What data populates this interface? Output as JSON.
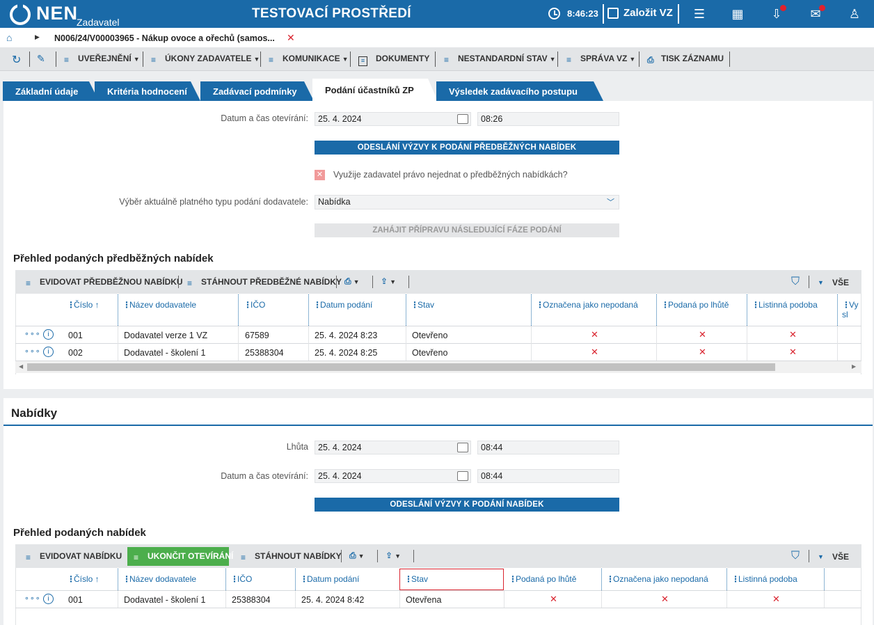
{
  "topbar": {
    "logo": "NEN",
    "logo_sub": "Zadavatel",
    "env_title": "TESTOVACÍ PROSTŘEDÍ",
    "time": "8:46:23",
    "create_label": "Založit VZ",
    "accent": "#1a6aa8"
  },
  "breadcrumb": {
    "text": "N006/24/V00003965 - Nákup ovoce a ořechů (samos..."
  },
  "toolbar": {
    "items": [
      "UVEŘEJNĚNÍ",
      "ÚKONY ZADAVATELE",
      "KOMUNIKACE",
      "DOKUMENTY",
      "NESTANDARDNÍ STAV",
      "SPRÁVA VZ",
      "TISK ZÁZNAMU"
    ]
  },
  "tabs": [
    "Základní údaje",
    "Kritéria hodnocení",
    "Zadávací podmínky",
    "Podání účastníků ZP",
    "Výsledek zadávacího postupu"
  ],
  "prelim": {
    "open_label": "Datum a čas otevírání:",
    "open_date": "25. 4. 2024",
    "open_time": "08:26",
    "send_btn": "ODESLÁNÍ VÝZVY K PODÁNÍ PŘEDBĚŽNÝCH NABÍDEK",
    "checkbox_label": "Využije zadavatel právo nejednat o předběžných nabídkách?",
    "type_label": "Výběr aktuálně platného typu podání dodavatele:",
    "type_value": "Nabídka",
    "next_btn": "ZAHÁJIT PŘÍPRAVU NÁSLEDUJÍCÍ FÁZE PODÁNÍ",
    "section_title": "Přehled podaných předběžných nabídek",
    "grid_actions": [
      "EVIDOVAT PŘEDBĚŽNOU NABÍDKU",
      "STÁHNOUT PŘEDBĚŽNÉ NABÍDKY"
    ],
    "filter_all": "VŠE",
    "columns": [
      "Číslo",
      "Název dodavatele",
      "IČO",
      "Datum podání",
      "Stav",
      "Označena jako nepodaná",
      "Podaná po lhůtě",
      "Listinná podoba",
      "Vy sl"
    ],
    "rows": [
      {
        "cislo": "001",
        "nazev": "Dodavatel verze 1 VZ",
        "ico": "67589",
        "datum": "25. 4. 2024 8:23",
        "stav": "Otevřeno"
      },
      {
        "cislo": "002",
        "nazev": "Dodavatel - školení 1",
        "ico": "25388304",
        "datum": "25. 4. 2024 8:25",
        "stav": "Otevřeno"
      }
    ]
  },
  "offers": {
    "title": "Nabídky",
    "deadline_label": "Lhůta",
    "deadline_date": "25. 4. 2024",
    "deadline_time": "08:44",
    "open_label": "Datum a čas otevírání:",
    "open_date": "25. 4. 2024",
    "open_time": "08:44",
    "send_btn": "ODESLÁNÍ VÝZVY K PODÁNÍ NABÍDEK",
    "section_title": "Přehled podaných nabídek",
    "grid_actions": [
      "EVIDOVAT NABÍDKU",
      "UKONČIT OTEVÍRÁNÍ",
      "STÁHNOUT NABÍDKY"
    ],
    "filter_all": "VŠE",
    "columns": [
      "Číslo",
      "Název dodavatele",
      "IČO",
      "Datum podání",
      "Stav",
      "Podaná po lhůtě",
      "Označena jako nepodaná",
      "Listinná podoba"
    ],
    "rows": [
      {
        "cislo": "001",
        "nazev": "Dodavatel - školení 1",
        "ico": "25388304",
        "datum": "25. 4. 2024 8:42",
        "stav": "Otevřena"
      }
    ]
  }
}
